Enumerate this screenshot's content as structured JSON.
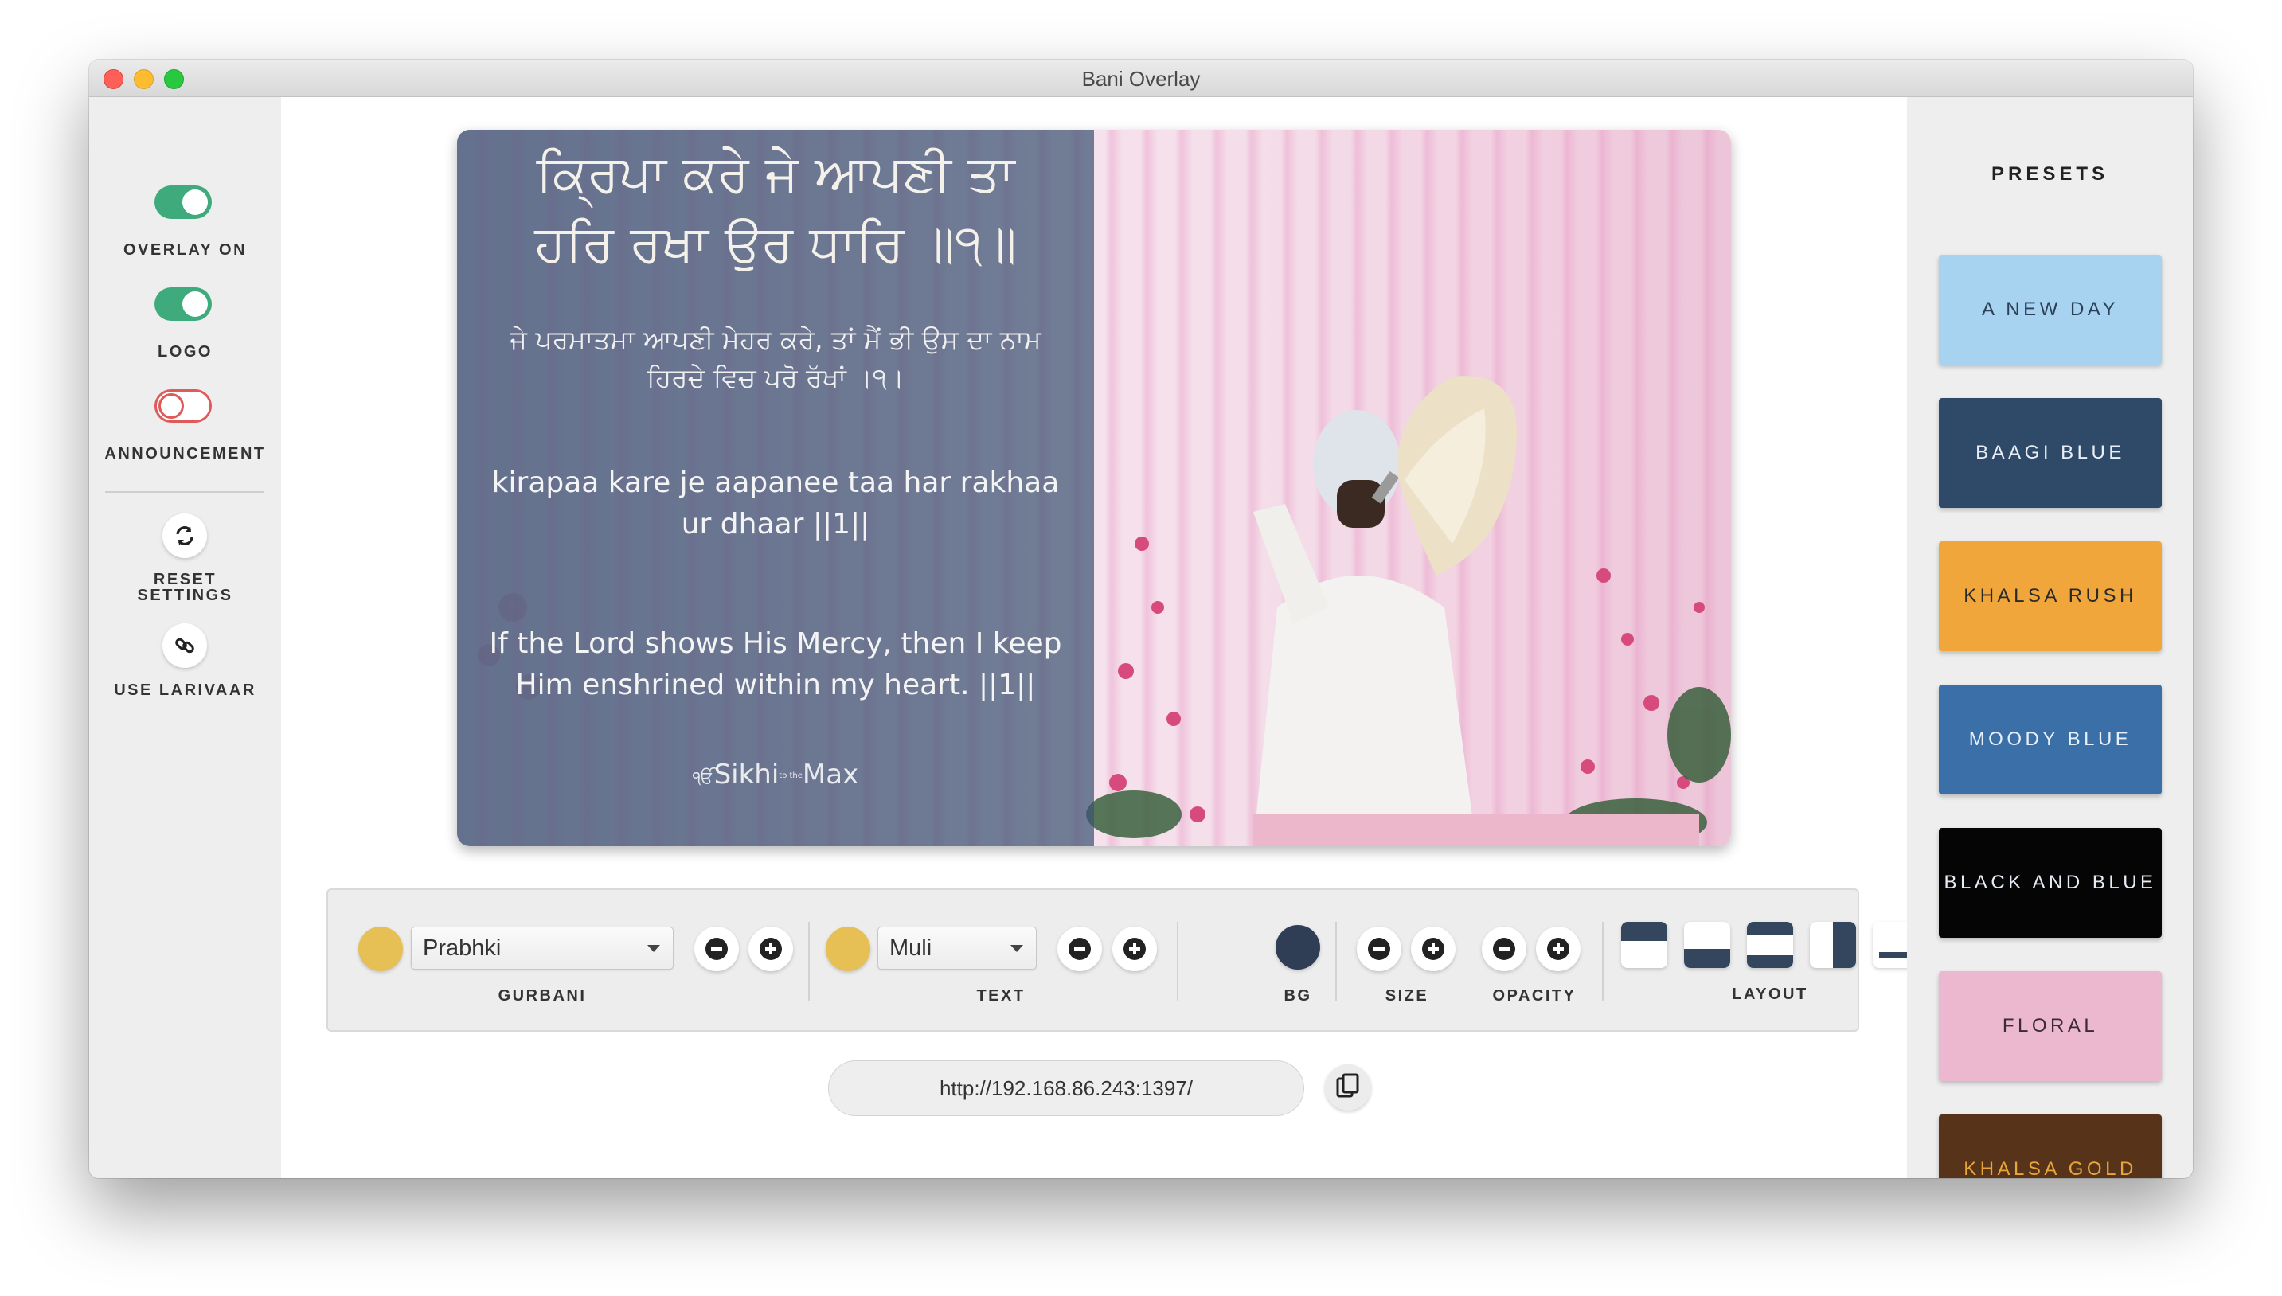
{
  "window": {
    "title": "Bani Overlay"
  },
  "sidebar": {
    "toggles": [
      {
        "label": "OVERLAY ON",
        "state": "on"
      },
      {
        "label": "LOGO",
        "state": "on"
      },
      {
        "label": "ANNOUNCEMENT",
        "state": "off"
      }
    ],
    "actions": [
      {
        "label_line1": "RESET",
        "label_line2": "SETTINGS",
        "icon": "refresh-icon"
      },
      {
        "label_line1": "USE LARIVAAR",
        "label_line2": "",
        "icon": "link-icon"
      }
    ]
  },
  "preview": {
    "gurbani": "ਕ੍ਰਿਪਾ ਕਰੇ ਜੇ ਆਪਣੀ ਤਾ ਹਰਿ ਰਖਾ ਉਰ ਧਾਰਿ ॥੧॥",
    "punjabi_translation": "ਜੇ ਪਰਮਾਤਮਾ ਆਪਣੀ ਮੇਹਰ ਕਰੇ, ਤਾਂ ਮੈਂ ਭੀ ਉਸ ਦਾ ਨਾਮ ਹਿਰਦੇ ਵਿਚ ਪਰੋ ਰੱਖਾਂ ।੧।",
    "transliteration": "kirapaa kare je aapanee taa har rakhaa ur dhaar ||1||",
    "english_translation": "If the Lord shows His Mercy, then I keep Him enshrined within my heart. ||1||",
    "logo_text": "Sikhi to the Max",
    "logo_prefix": "ੴ",
    "logo_main": "Sikhi",
    "logo_small": "to the",
    "logo_end": "Max"
  },
  "toolbar": {
    "gurbani": {
      "font": "Prabhki",
      "label": "GURBANI",
      "color": "#e6c054"
    },
    "text": {
      "font": "Muli",
      "label": "TEXT",
      "color": "#e6c054"
    },
    "bg": {
      "label": "BG",
      "color": "#2f3e55"
    },
    "size": {
      "label": "SIZE"
    },
    "opacity": {
      "label": "OPACITY"
    },
    "layout": {
      "label": "LAYOUT"
    }
  },
  "url": {
    "value": "http://192.168.86.243:1397/"
  },
  "presets": {
    "title": "PRESETS",
    "items": [
      {
        "label": "A NEW DAY",
        "bg": "#a7d3f0",
        "fg": "#2b3f57"
      },
      {
        "label": "BAAGI BLUE",
        "bg": "#2f4a68",
        "fg": "#e8eef5"
      },
      {
        "label": "KHALSA RUSH",
        "bg": "#f0a63a",
        "fg": "#2a2a2a"
      },
      {
        "label": "MOODY BLUE",
        "bg": "#3b6fa8",
        "fg": "#e8f0fa"
      },
      {
        "label": "BLACK AND BLUE",
        "bg": "#050505",
        "fg": "#e6ecf5"
      },
      {
        "label": "FLORAL",
        "bg": "#ebb8cf",
        "fg": "#3a2b36"
      },
      {
        "label": "KHALSA GOLD",
        "bg": "#57331a",
        "fg": "#e6a63a"
      }
    ]
  }
}
